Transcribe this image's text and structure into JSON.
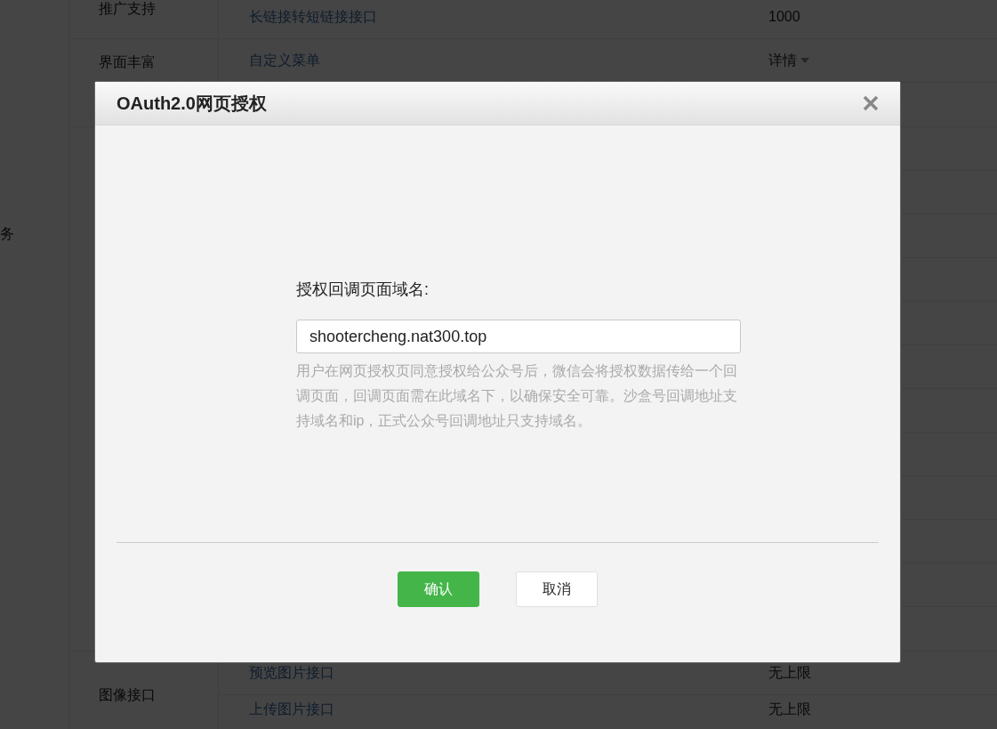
{
  "page_table": {
    "side_label": "务",
    "sections": [
      {
        "category": "推广支持",
        "rows": [
          {},
          {
            "name": "长链接转短链接接口",
            "value": "1000"
          }
        ]
      },
      {
        "category": "界面丰富",
        "rows": [
          {
            "name": "自定义菜单",
            "value": "详情",
            "dropdown": true
          },
          {}
        ]
      },
      {
        "rows": [
          {},
          {},
          {},
          {},
          {},
          {},
          {},
          {},
          {},
          {},
          {},
          {}
        ]
      },
      {
        "category": "图像接口",
        "rows": [
          {
            "name": "预览图片接口",
            "value": "无上限"
          },
          {
            "name": "上传图片接口",
            "value": "无上限"
          }
        ]
      }
    ]
  },
  "dialog": {
    "title": "OAuth2.0网页授权",
    "field_label": "授权回调页面域名:",
    "field_value": "shootercheng.nat300.top",
    "help": "用户在网页授权页同意授权给公众号后，微信会将授权数据传给一个回调页面，回调页面需在此域名下，以确保安全可靠。沙盒号回调地址支持域名和ip，正式公众号回调地址只支持域名。",
    "buttons": [
      {
        "label": "确认",
        "kind": "primary"
      },
      {
        "label": "取消",
        "kind": "default"
      }
    ]
  }
}
